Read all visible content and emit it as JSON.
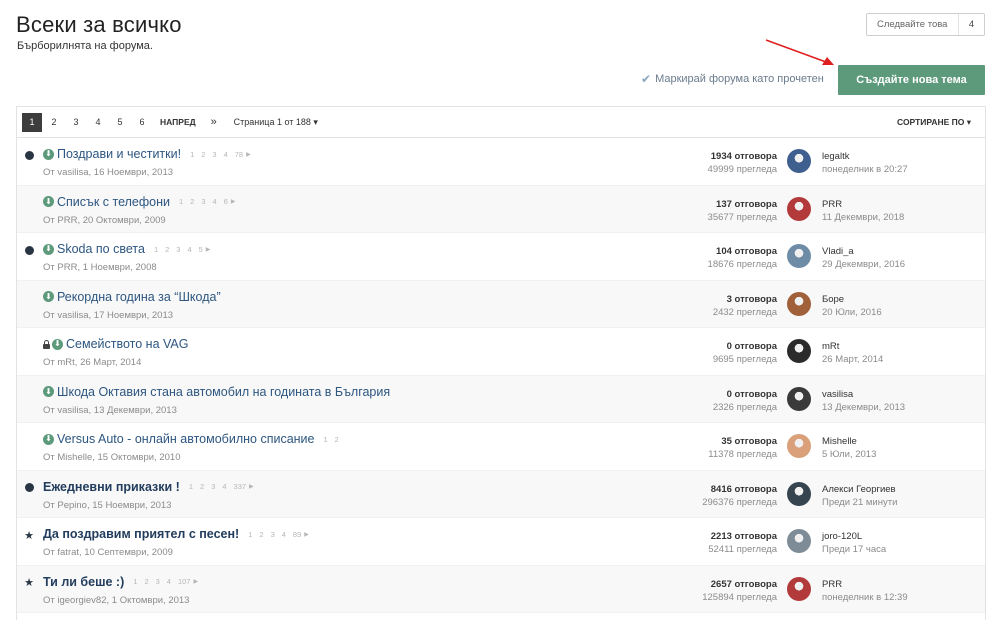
{
  "header": {
    "title": "Всеки за всичко",
    "subtitle": "Бърборилнята на форума.",
    "follow_label": "Следвайте това",
    "follow_count": "4",
    "mark_read": "Маркирай форума като прочетен",
    "new_topic": "Създайте нова тема"
  },
  "pager": {
    "pages": [
      "1",
      "2",
      "3",
      "4",
      "5",
      "6"
    ],
    "next": "НАПРЕД",
    "last": "»",
    "page_of": "Страница 1 от 188 ▾",
    "sort": "СОРТИРАНЕ ПО ▾"
  },
  "colors": {
    "accent": "#5d9a7b",
    "link": "#2d5680",
    "muted": "#8b8b8b"
  },
  "topics": [
    {
      "marker": "dot",
      "pinned": true,
      "locked": false,
      "bold": false,
      "title": "Поздрави и честитки!",
      "pages": [
        "1",
        "2",
        "3",
        "4",
        "78"
      ],
      "meta": "От vasilisa, 16 Ноември, 2013",
      "replies": "1934 отговора",
      "views": "49999 прегледа",
      "last_user": "legaltk",
      "last_time": "понеделник в 20:27",
      "avatar_color": "#3f5f8f"
    },
    {
      "marker": "none",
      "pinned": true,
      "locked": false,
      "bold": false,
      "title": "Списък с телефони",
      "pages": [
        "1",
        "2",
        "3",
        "4",
        "6"
      ],
      "meta": "От PRR, 20 Октомври, 2009",
      "replies": "137 отговора",
      "views": "35677 прегледа",
      "last_user": "PRR",
      "last_time": "11 Декември, 2018",
      "avatar_color": "#b23a3a"
    },
    {
      "marker": "dot",
      "pinned": true,
      "locked": false,
      "bold": false,
      "title": "Skoda по света",
      "pages": [
        "1",
        "2",
        "3",
        "4",
        "5"
      ],
      "meta": "От PRR, 1 Ноември, 2008",
      "replies": "104 отговора",
      "views": "18676 прегледа",
      "last_user": "Vladi_a",
      "last_time": "29 Декември, 2016",
      "avatar_color": "#6f8ca6"
    },
    {
      "marker": "none",
      "pinned": true,
      "locked": false,
      "bold": false,
      "title": "Рекордна година за “Шкода”",
      "pages": [],
      "meta": "От vasilisa, 17 Ноември, 2013",
      "replies": "3 отговора",
      "views": "2432 прегледа",
      "last_user": "Боре",
      "last_time": "20 Юли, 2016",
      "avatar_color": "#a0603a"
    },
    {
      "marker": "none",
      "pinned": true,
      "locked": true,
      "bold": false,
      "title": "Семейството на VAG",
      "pages": [],
      "meta": "От mRt, 26 Март, 2014",
      "replies": "0 отговора",
      "views": "9695 прегледа",
      "last_user": "mRt",
      "last_time": "26 Март, 2014",
      "avatar_color": "#2b2b2b"
    },
    {
      "marker": "none",
      "pinned": true,
      "locked": false,
      "bold": false,
      "title": "Шкода Октавия стана автомобил на годината в България",
      "pages": [],
      "meta": "От vasilisa, 13 Декември, 2013",
      "replies": "0 отговора",
      "views": "2326 прегледа",
      "last_user": "vasilisa",
      "last_time": "13 Декември, 2013",
      "avatar_color": "#3a3a3a"
    },
    {
      "marker": "none",
      "pinned": true,
      "locked": false,
      "bold": false,
      "title": "Versus Auto - онлайн автомобилно списание",
      "pages": [
        "1",
        "2"
      ],
      "meta": "От Mishelle, 15 Октомври, 2010",
      "replies": "35 отговора",
      "views": "11378 прегледа",
      "last_user": "Mishelle",
      "last_time": "5 Юли, 2013",
      "avatar_color": "#d9a07a"
    },
    {
      "marker": "dot",
      "pinned": false,
      "locked": false,
      "bold": true,
      "title": "Ежедневни приказки !",
      "pages": [
        "1",
        "2",
        "3",
        "4",
        "337"
      ],
      "meta": "От Pepino, 15 Ноември, 2013",
      "replies": "8416 отговора",
      "views": "296376 прегледа",
      "last_user": "Алекси Георгиев",
      "last_time": "Преди 21 минути",
      "avatar_color": "#36444f"
    },
    {
      "marker": "star",
      "pinned": false,
      "locked": false,
      "bold": true,
      "title": "Да поздравим приятел с песен!",
      "pages": [
        "1",
        "2",
        "3",
        "4",
        "89"
      ],
      "meta": "От fatrat, 10 Септември, 2009",
      "replies": "2213 отговора",
      "views": "52411 прегледа",
      "last_user": "joro-120L",
      "last_time": "Преди 17 часа",
      "avatar_color": "#7d8c96"
    },
    {
      "marker": "star",
      "pinned": false,
      "locked": false,
      "bold": true,
      "title": "Ти ли беше :)",
      "pages": [
        "1",
        "2",
        "3",
        "4",
        "107"
      ],
      "meta": "От igeorgiev82, 1 Октомври, 2013",
      "replies": "2657 отговора",
      "views": "125894 прегледа",
      "last_user": "PRR",
      "last_time": "понеделник в 12:39",
      "avatar_color": "#b23a3a"
    }
  ]
}
